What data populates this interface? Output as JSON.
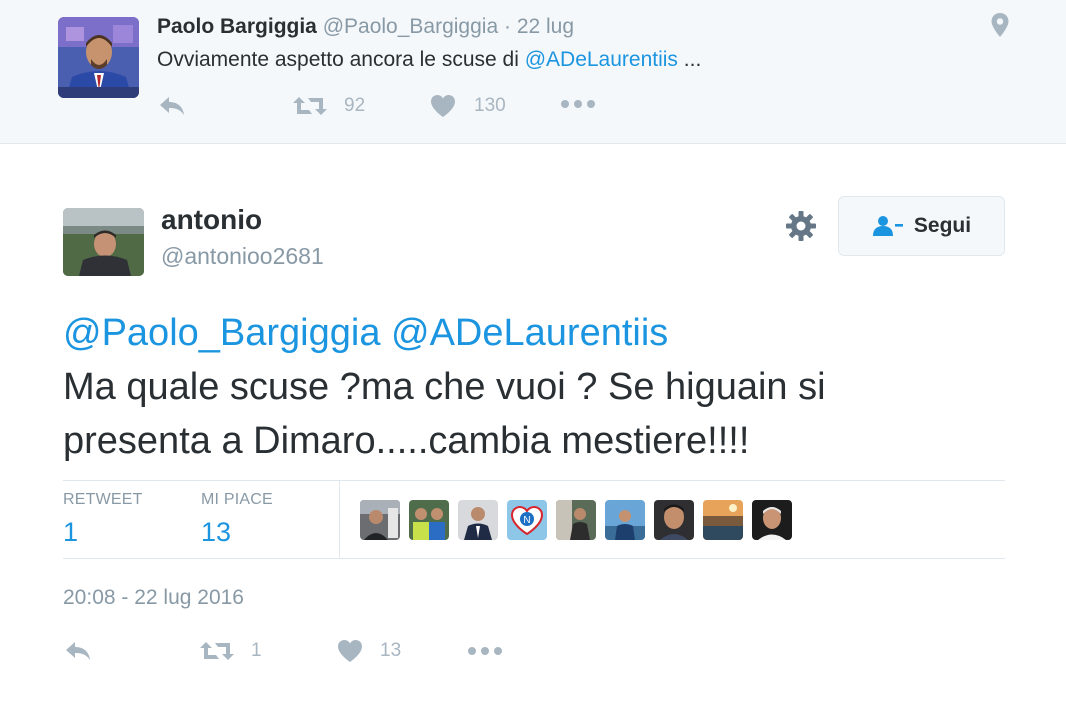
{
  "parent_tweet": {
    "name": "Paolo Bargiggia",
    "handle": "@Paolo_Bargiggia",
    "separator": "·",
    "date": "22 lug",
    "text_prefix": "Ovviamente aspetto ancora le scuse di ",
    "text_mention": "@ADeLaurentiis",
    "text_suffix": " ...",
    "retweets": "92",
    "likes": "130"
  },
  "main_tweet": {
    "name": "antonio",
    "handle": "@antonioo2681",
    "follow_label": "Segui",
    "mentions": "@Paolo_Bargiggia @ADeLaurentiis",
    "text_line1": "Ma quale scuse ?ma che vuoi ? Se higuain si",
    "text_line2": "presenta a Dimaro.....cambia mestiere!!!!",
    "stats": {
      "retweet_label": "RETWEET",
      "retweet_value": "1",
      "like_label": "MI PIACE",
      "like_value": "13"
    },
    "timestamp": "20:08 - 22 lug 2016",
    "action_retweets": "1",
    "action_likes": "13"
  },
  "colors": {
    "accent": "#1b95e0",
    "muted": "#8899a6",
    "parent_bg": "#f5f8fa",
    "border": "#e1e8ed"
  },
  "icons": [
    "reply-icon",
    "retweet-icon",
    "heart-icon",
    "more-icon",
    "location-pin-icon",
    "gear-icon",
    "follow-person-icon"
  ]
}
